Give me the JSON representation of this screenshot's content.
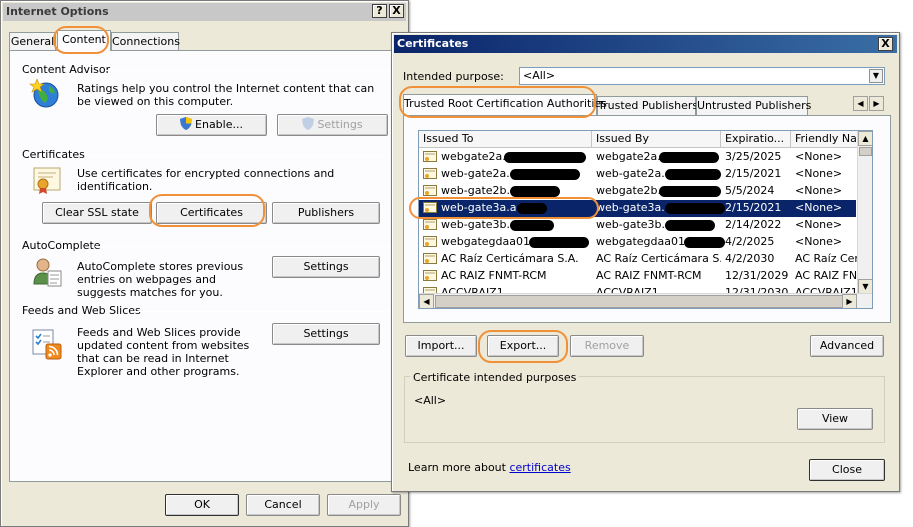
{
  "internet_options": {
    "title": "Internet Options",
    "help_glyph": "?",
    "close_glyph": "X",
    "tabs": [
      "General",
      "Content",
      "Connections"
    ],
    "content_advisor": {
      "heading": "Content Advisor",
      "desc": "Ratings help you control the Internet content that can be viewed on this computer.",
      "enable": "Enable...",
      "settings": "Settings"
    },
    "certificates": {
      "heading": "Certificates",
      "desc": "Use certificates for encrypted connections and identification.",
      "clear_ssl": "Clear SSL state",
      "certificates": "Certificates",
      "publishers": "Publishers"
    },
    "autocomplete": {
      "heading": "AutoComplete",
      "desc": "AutoComplete stores previous entries on webpages and suggests matches for you.",
      "settings": "Settings"
    },
    "feeds": {
      "heading": "Feeds and Web Slices",
      "desc": "Feeds and Web Slices provide updated content from websites that can be read in Internet Explorer and other programs.",
      "settings": "Settings"
    },
    "ok": "OK",
    "cancel": "Cancel",
    "apply": "Apply"
  },
  "certificates_dialog": {
    "title": "Certificates",
    "close_glyph": "X",
    "intended_purpose_label": "Intended purpose:",
    "intended_purpose_value": "<All>",
    "tabs": [
      "Trusted Root Certification Authorities",
      "Trusted Publishers",
      "Untrusted Publishers"
    ],
    "columns": [
      "Issued To",
      "Issued By",
      "Expiratio...",
      "Friendly Nam"
    ],
    "rows": [
      {
        "issued_to": "webgate2a.",
        "issued_by": "webgate2a.",
        "expiration": "3/25/2025",
        "friendly": "<None>"
      },
      {
        "issued_to": "web-gate2a.",
        "issued_by": "web-gate2a.",
        "expiration": "2/15/2021",
        "friendly": "<None>"
      },
      {
        "issued_to": "web-gate2b.",
        "issued_by": "webgate2b.",
        "expiration": "5/5/2024",
        "friendly": "<None>"
      },
      {
        "issued_to": "web-gate3a.a",
        "issued_by": "web-gate3a.",
        "expiration": "2/15/2021",
        "friendly": "<None>"
      },
      {
        "issued_to": "web-gate3b.",
        "issued_by": "web-gate3b.",
        "expiration": "2/14/2022",
        "friendly": "<None>"
      },
      {
        "issued_to": "webgategdaa01.",
        "issued_by": "webgategdaa01.",
        "expiration": "4/2/2025",
        "friendly": "<None>"
      },
      {
        "issued_to": "AC Raíz Certicámara S.A.",
        "issued_by": "AC Raíz Certicámara S.A.",
        "expiration": "4/2/2030",
        "friendly": "AC Raíz Cert"
      },
      {
        "issued_to": "AC RAIZ FNMT-RCM",
        "issued_by": "AC RAIZ FNMT-RCM",
        "expiration": "12/31/2029",
        "friendly": "AC RAIZ FN"
      },
      {
        "issued_to": "ACCVRAIZ1",
        "issued_by": "ACCVRAIZ1",
        "expiration": "12/31/2030",
        "friendly": "ACCVRAIZ1"
      }
    ],
    "selected_row": 3,
    "import": "Import...",
    "export": "Export...",
    "remove": "Remove",
    "advanced": "Advanced",
    "purposes_group": "Certificate intended purposes",
    "purposes_value": "<All>",
    "view": "View",
    "learn_more_prefix": "Learn more about ",
    "learn_more_link": "certificates",
    "close": "Close"
  },
  "colors": {
    "window_bg": "#ece9d8",
    "highlight": "#0a246a",
    "annotation": "#f0913a",
    "link": "#0000cc"
  },
  "icons": {
    "content_advisor": "globe-star-icon",
    "certificates": "certificate-icon",
    "autocomplete": "user-form-icon",
    "feeds": "rss-feed-icon",
    "enable_shield": "uac-shield-icon",
    "cert_row": "certificate-row-icon"
  }
}
